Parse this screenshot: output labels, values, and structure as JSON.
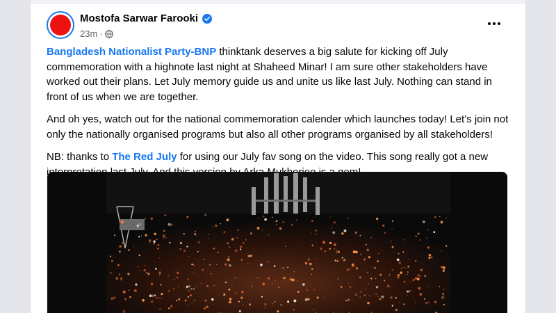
{
  "post": {
    "author": "Mostofa Sarwar Farooki",
    "time": "23m",
    "separator": "·",
    "paragraph1": {
      "link": "Bangladesh Nationalist Party-BNP",
      "text": " thinktank deserves a big salute for kicking off July commemoration with a highnote last night at Shaheed Minar! I am sure other stakeholders have worked out their plans. Let July memory guide us and unite us like last July. Nothing can stand in front of us when we are together."
    },
    "paragraph2": "And oh yes, watch out for the national commemoration calender which launches today! Let’s join not only the nationally organised programs but also all other programs organised by all stakeholders!",
    "paragraph3": {
      "before": "NB: thanks to ",
      "link": "The Red July",
      "after": " for using our July fav song on the video. This song really got a new interpretation last July. And this version by Arka Mukherjee is a gem!"
    }
  },
  "icons": {
    "verified": "verified-badge-icon",
    "globe": "globe-icon",
    "more": "more-options-icon"
  },
  "colors": {
    "link": "#1877f2",
    "text": "#050505",
    "meta": "#65676b",
    "avatar": "#ee1111",
    "candle": "#ff9a4d"
  }
}
